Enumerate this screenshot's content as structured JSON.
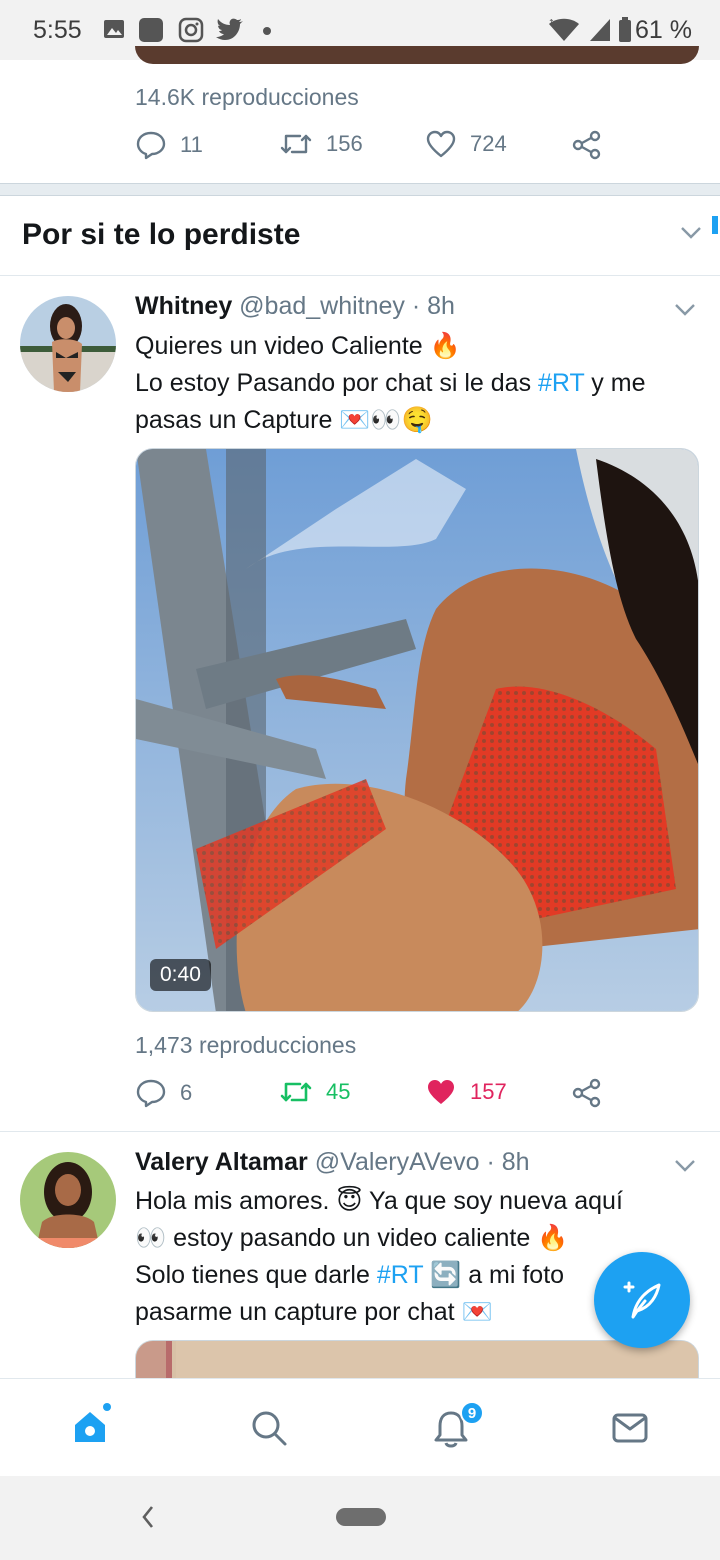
{
  "status_bar": {
    "time": "5:55",
    "battery_pct": "61 %",
    "icons": [
      "image-icon",
      "app-square-icon",
      "instagram-icon",
      "twitter-icon",
      "dot-icon",
      "wifi-icon",
      "signal-icon",
      "battery-icon"
    ]
  },
  "prev_tweet": {
    "views": "14.6K reproducciones",
    "replies": "11",
    "retweets": "156",
    "likes": "724"
  },
  "section": {
    "title": "Por si te lo perdiste"
  },
  "tweets": [
    {
      "name": "Whitney",
      "meta": "@bad_whitney · 8h",
      "lines": [
        {
          "text": "Quieres un video Caliente 🔥"
        },
        {
          "pre": "Lo estoy Pasando por chat si le das ",
          "tag": "#RT",
          "post": " y me"
        },
        {
          "text": "pasas un Capture 💌👀🤤"
        }
      ],
      "video_duration": "0:40",
      "views": "1,473 reproducciones",
      "replies": "6",
      "retweets": "45",
      "likes": "157",
      "retweeted": true,
      "liked": true
    },
    {
      "name": "Valery Altamar",
      "meta": "@ValeryAVevo · 8h",
      "lines": [
        {
          "text": "Hola mis amores. 😇 Ya que soy nueva aquí"
        },
        {
          "text": "👀 estoy pasando un video caliente 🔥"
        },
        {
          "pre": "Solo tienes que darle ",
          "tag": "#RT",
          "post": " 🔄 a mi foto"
        },
        {
          "text": "pasarme un capture por chat 💌"
        }
      ]
    }
  ],
  "bottom_nav": {
    "items": [
      "home-icon",
      "search-icon",
      "notifications-icon",
      "messages-icon"
    ],
    "notification_badge": "9"
  },
  "colors": {
    "accent": "#1da1f2",
    "retweet_green": "#17bf63",
    "like_red": "#e0245e",
    "secondary_text": "#657786"
  }
}
